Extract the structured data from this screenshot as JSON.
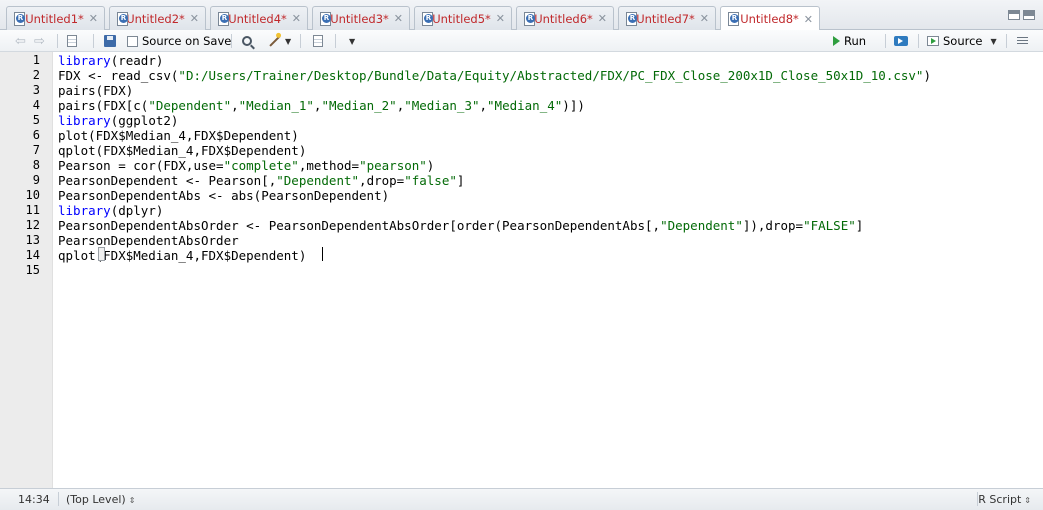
{
  "tabs": [
    {
      "label": "Untitled1*",
      "active": false
    },
    {
      "label": "Untitled2*",
      "active": false
    },
    {
      "label": "Untitled4*",
      "active": false
    },
    {
      "label": "Untitled3*",
      "active": false
    },
    {
      "label": "Untitled5*",
      "active": false
    },
    {
      "label": "Untitled6*",
      "active": false
    },
    {
      "label": "Untitled7*",
      "active": false
    },
    {
      "label": "Untitled8*",
      "active": true
    }
  ],
  "toolbar": {
    "source_on_save_label": "Source on Save",
    "run_label": "Run",
    "source_label": "Source"
  },
  "editor": {
    "line_numbers": [
      "1",
      "2",
      "3",
      "4",
      "5",
      "6",
      "7",
      "8",
      "9",
      "10",
      "11",
      "12",
      "13",
      "14",
      "15"
    ],
    "lines": [
      [
        {
          "t": "library",
          "c": "kw"
        },
        {
          "t": "(readr)"
        }
      ],
      [
        {
          "t": "FDX <- read_csv("
        },
        {
          "t": "\"D:/Users/Trainer/Desktop/Bundle/Data/Equity/Abstracted/FDX/PC_FDX_Close_200x1D_Close_50x1D_10.csv\"",
          "c": "str"
        },
        {
          "t": ")"
        }
      ],
      [
        {
          "t": "pairs(FDX)"
        }
      ],
      [
        {
          "t": "pairs(FDX[c("
        },
        {
          "t": "\"Dependent\"",
          "c": "str"
        },
        {
          "t": ","
        },
        {
          "t": "\"Median_1\"",
          "c": "str"
        },
        {
          "t": ","
        },
        {
          "t": "\"Median_2\"",
          "c": "str"
        },
        {
          "t": ","
        },
        {
          "t": "\"Median_3\"",
          "c": "str"
        },
        {
          "t": ","
        },
        {
          "t": "\"Median_4\"",
          "c": "str"
        },
        {
          "t": ")])"
        }
      ],
      [
        {
          "t": "library",
          "c": "kw"
        },
        {
          "t": "(ggplot2)"
        }
      ],
      [
        {
          "t": "plot(FDX$Median_4,FDX$Dependent)"
        }
      ],
      [
        {
          "t": "qplot(FDX$Median_4,FDX$Dependent)"
        }
      ],
      [
        {
          "t": "Pearson = cor(FDX,use="
        },
        {
          "t": "\"complete\"",
          "c": "str"
        },
        {
          "t": ",method="
        },
        {
          "t": "\"pearson\"",
          "c": "str"
        },
        {
          "t": ")"
        }
      ],
      [
        {
          "t": "PearsonDependent <- Pearson[,"
        },
        {
          "t": "\"Dependent\"",
          "c": "str"
        },
        {
          "t": ",drop="
        },
        {
          "t": "\"false\"",
          "c": "str"
        },
        {
          "t": "]"
        }
      ],
      [
        {
          "t": "PearsonDependentAbs <- abs(PearsonDependent)"
        }
      ],
      [
        {
          "t": "library",
          "c": "kw"
        },
        {
          "t": "(dplyr)"
        }
      ],
      [
        {
          "t": "PearsonDependentAbsOrder <- PearsonDependentAbsOrder[order(PearsonDependentAbs[,"
        },
        {
          "t": "\"Dependent\"",
          "c": "str"
        },
        {
          "t": "]),drop="
        },
        {
          "t": "\"FALSE\"",
          "c": "str"
        },
        {
          "t": "]"
        }
      ],
      [
        {
          "t": "PearsonDependentAbsOrder"
        }
      ],
      [
        {
          "t": "qplot(FDX$Median_4,FDX$Dependent)"
        }
      ],
      []
    ]
  },
  "status": {
    "cursor_position": "14:34",
    "scope": "(Top Level)",
    "file_type": "R Script"
  }
}
